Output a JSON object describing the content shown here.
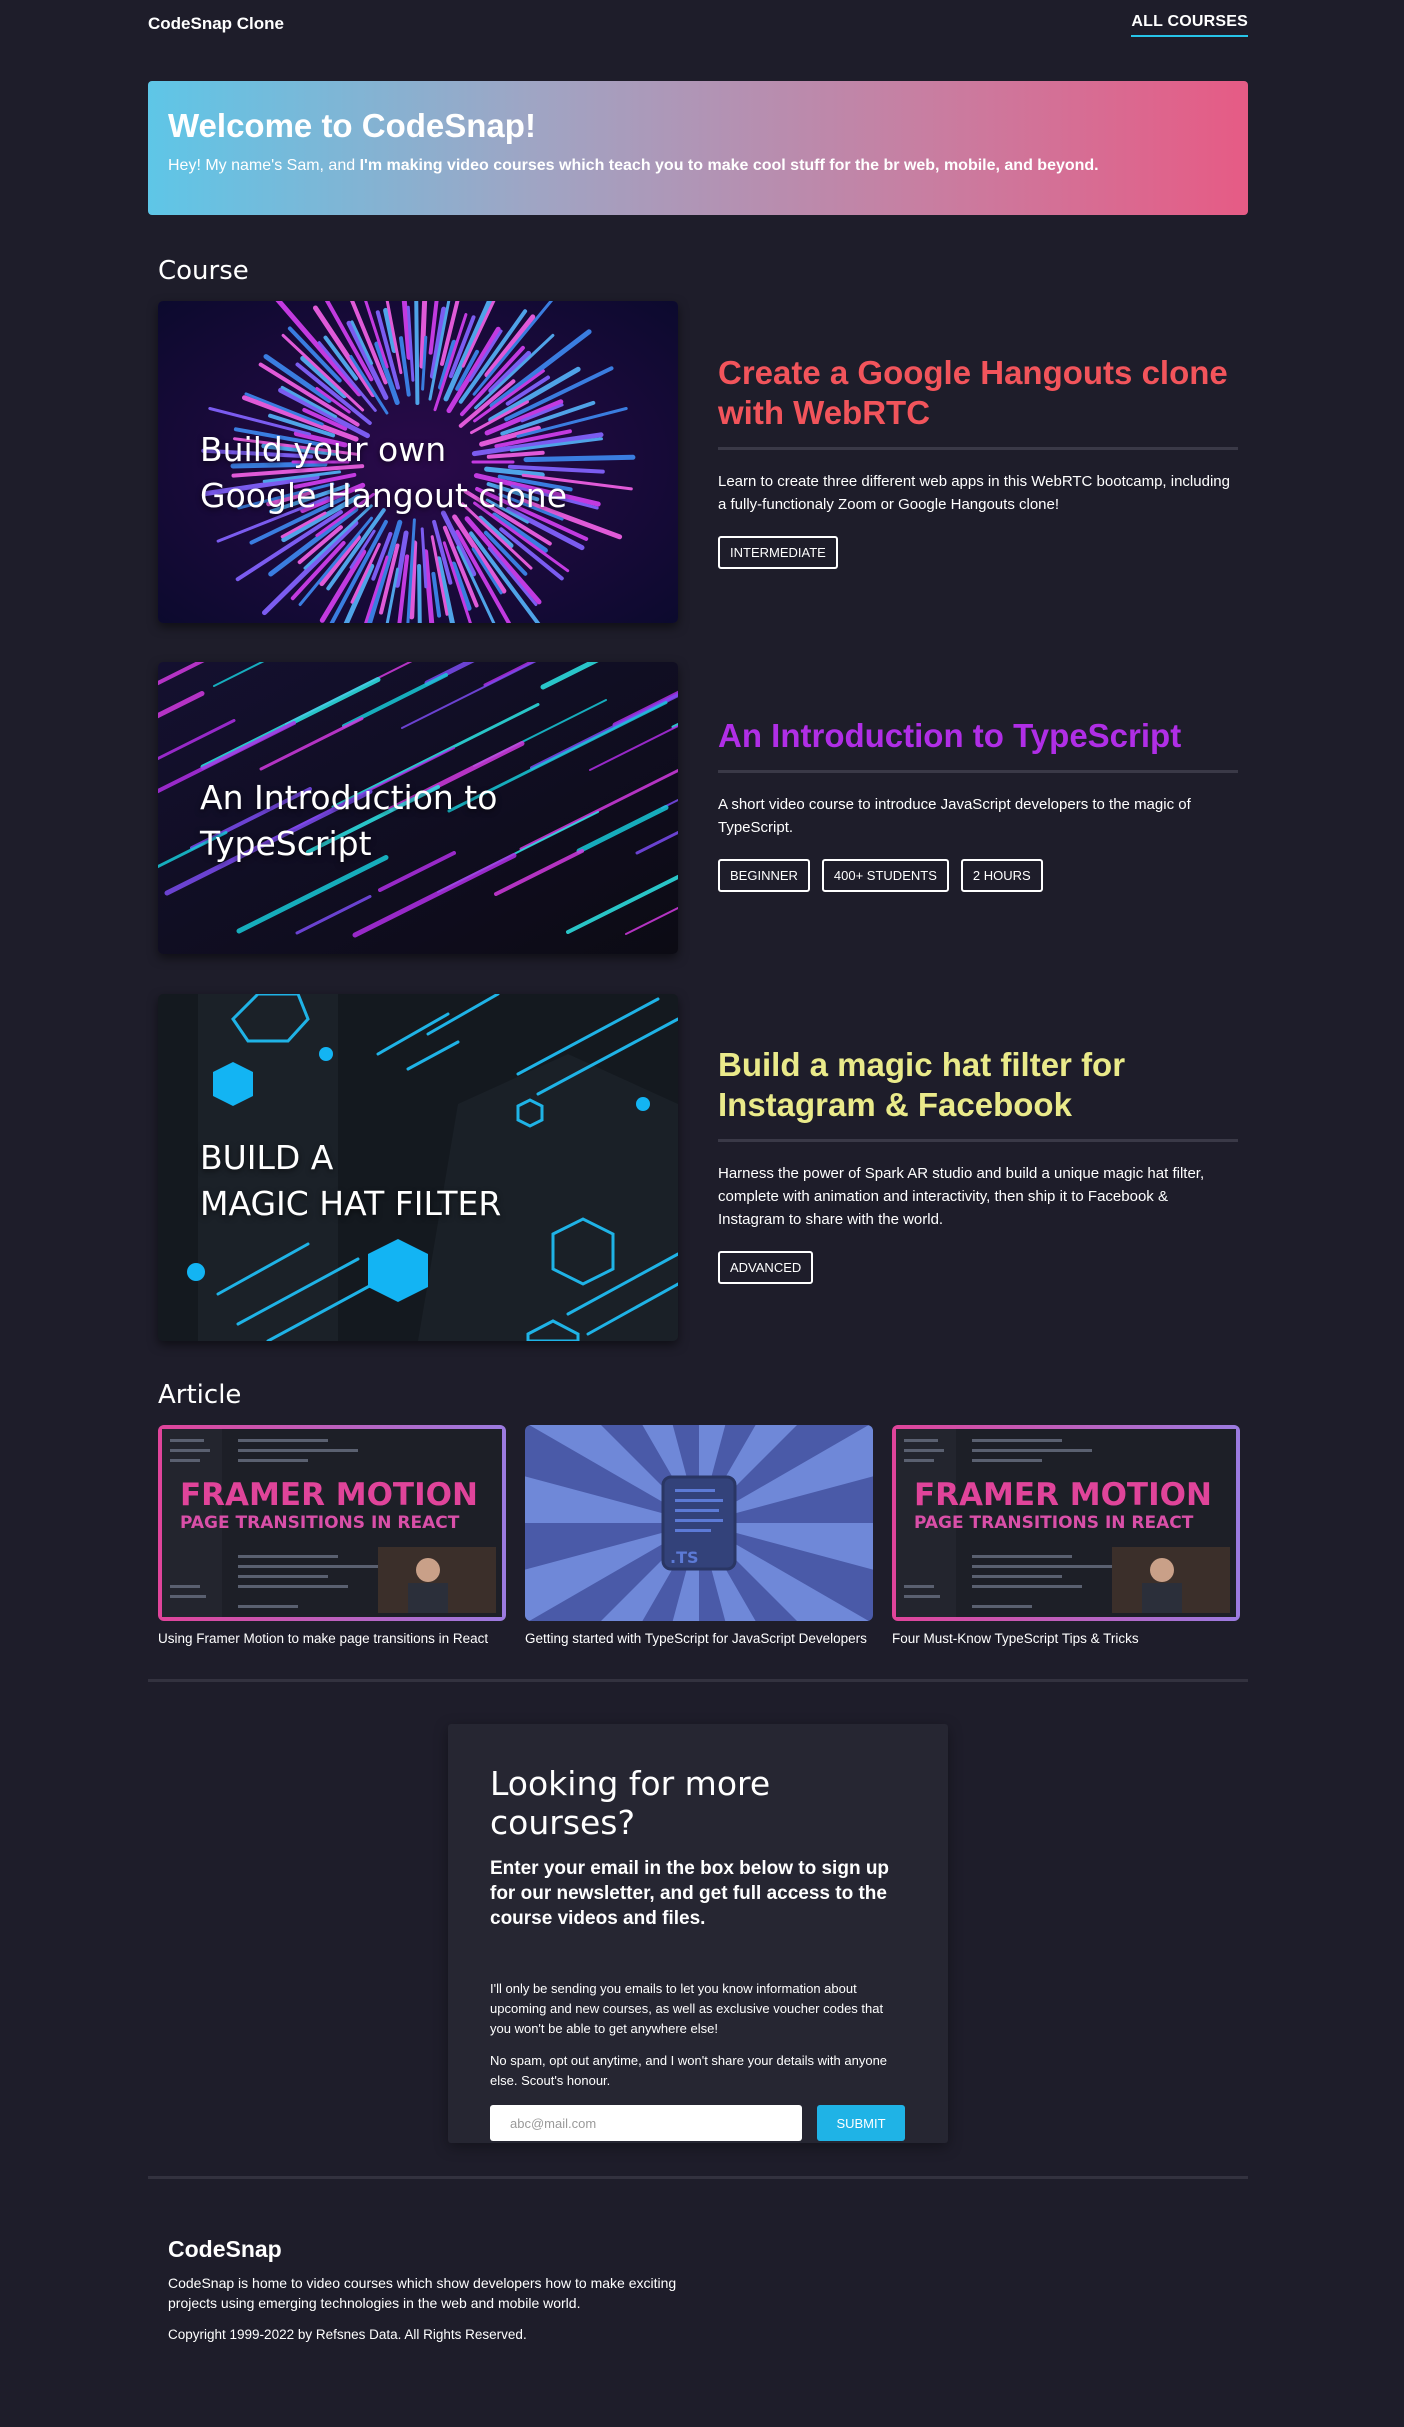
{
  "nav": {
    "brand": "CodeSnap Clone",
    "link": "ALL COURSES"
  },
  "hero": {
    "title": "Welcome to CodeSnap!",
    "intro": "Hey! My name's Sam, and ",
    "emphasis": "I'm making video courses which teach you to make cool stuff for the br web, mobile, and beyond."
  },
  "sections": {
    "course": "Course",
    "article": "Article"
  },
  "courses": [
    {
      "image_text_line1": "Build your own",
      "image_text_line2": "Google Hangout clone",
      "title": "Create a Google Hangouts clone with WebRTC",
      "title_color": "#f2545b",
      "description": "Learn to create three different web apps in this WebRTC bootcamp, including a fully-functionaly Zoom or Google Hangouts clone!",
      "tags": [
        "INTERMEDIATE"
      ]
    },
    {
      "image_text_line1": "An Introduction to",
      "image_text_line2": "TypeScript",
      "title": "An Introduction to TypeScript",
      "title_color": "#b02ee6",
      "description": "A short video course to introduce JavaScript developers to the magic of TypeScript.",
      "tags": [
        "BEGINNER",
        "400+ STUDENTS",
        "2 HOURS"
      ]
    },
    {
      "image_text_line1": "BUILD A",
      "image_text_line2": "MAGIC HAT FILTER",
      "title": "Build a magic hat filter for Instagram & Facebook",
      "title_color": "#eaea8a",
      "description": "Harness the power of Spark AR studio and build a unique magic hat filter, complete with animation and interactivity, then ship it to Facebook & Instagram to share with the world.",
      "tags": [
        "ADVANCED"
      ]
    }
  ],
  "articles": [
    {
      "thumb_line1": "FRAMER MOTION",
      "thumb_line2": "PAGE TRANSITIONS IN REACT",
      "caption": "Using Framer Motion to make page transitions in React"
    },
    {
      "thumb_label": ".TS",
      "caption": "Getting started with TypeScript for JavaScript Developers"
    },
    {
      "thumb_line1": "FRAMER MOTION",
      "thumb_line2": "PAGE TRANSITIONS IN REACT",
      "caption": "Four Must-Know TypeScript Tips & Tricks"
    }
  ],
  "newsletter": {
    "title": "Looking for more courses?",
    "lead": "Enter your email in the box below to sign up for our newsletter, and get full access to the course videos and files.",
    "p1": "I'll only be sending you emails to let you know information about upcoming and new courses, as well as exclusive voucher codes that you won't be able to get anywhere else!",
    "p2": "No spam, opt out anytime, and I won't share your details with anyone else. Scout's honour.",
    "placeholder": "abc@mail.com",
    "submit": "SUBMIT"
  },
  "footer": {
    "brand": "CodeSnap",
    "description": "CodeSnap is home to video courses which show developers how to make exciting projects using emerging technologies in the web and mobile world.",
    "copyright": "Copyright 1999-2022 by Refsnes Data. All Rights Reserved."
  },
  "colors": {
    "accent": "#27c4e8",
    "background": "#1e1d2a",
    "card": "#262632",
    "button": "#1fb3e6"
  }
}
